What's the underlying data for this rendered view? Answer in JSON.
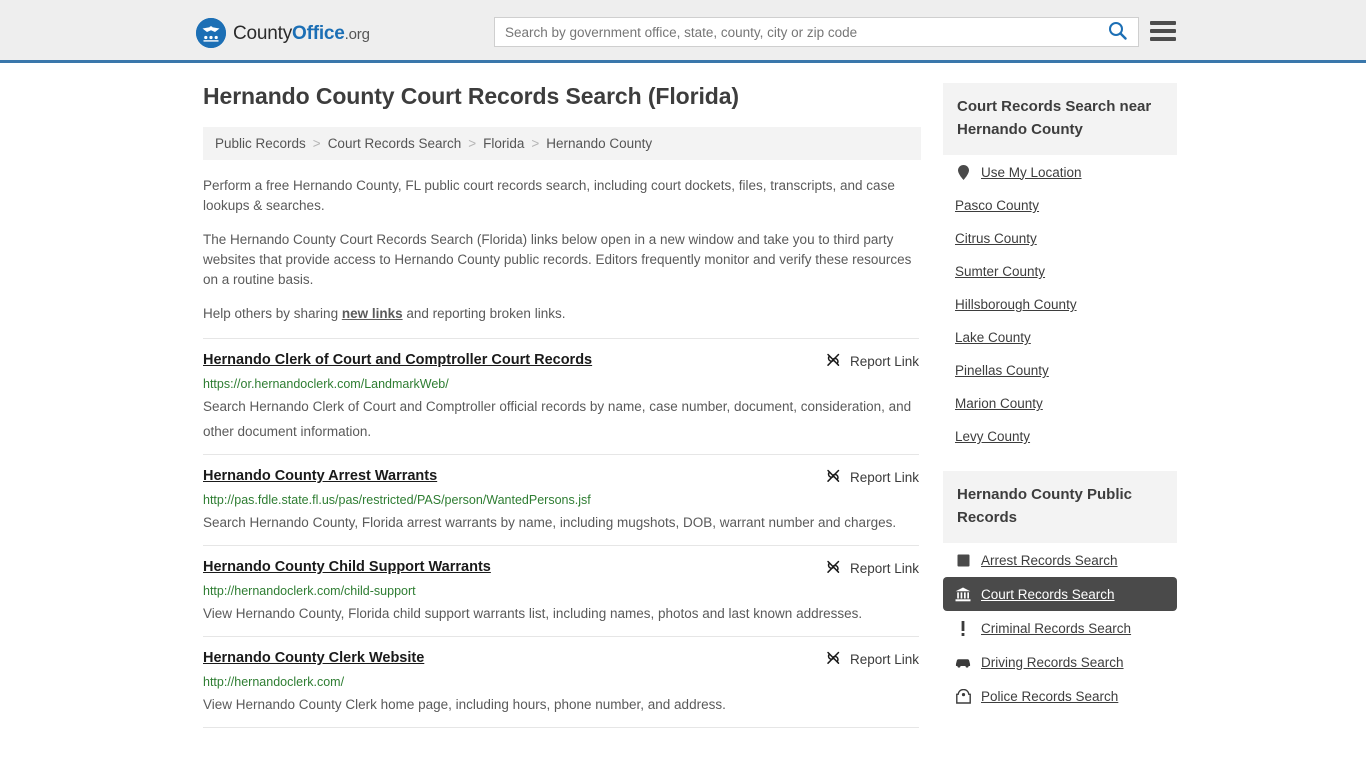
{
  "header": {
    "logo": {
      "name": "CountyOffice.org",
      "part1": "County",
      "part2": "Office",
      "part3": ".org",
      "icon": "eagle-seal-icon",
      "color": "#1c6fb5"
    },
    "search": {
      "placeholder": "Search by government office, state, county, city or zip code",
      "value": "",
      "button_icon": "search-icon",
      "button_color": "#1c6fb5"
    },
    "menu_icon": "hamburger-menu-icon",
    "background": "#eeeeee",
    "accent_border": "#3a77ab"
  },
  "main": {
    "title": "Hernando County Court Records Search (Florida)",
    "breadcrumb": {
      "separator": ">",
      "items": [
        {
          "label": "Public Records",
          "current": false
        },
        {
          "label": "Court Records Search",
          "current": false
        },
        {
          "label": "Florida",
          "current": false
        },
        {
          "label": "Hernando County",
          "current": true
        }
      ]
    },
    "paragraphs": [
      "Perform a free Hernando County, FL public court records search, including court dockets, files, transcripts, and case lookups & searches.",
      "The Hernando County Court Records Search (Florida) links below open in a new window and take you to third party websites that provide access to Hernando County public records. Editors frequently monitor and verify these resources on a routine basis."
    ],
    "help_line": {
      "before": "Help others by sharing ",
      "link": "new links",
      "after": " and reporting broken links."
    },
    "report_label": "Report Link",
    "report_icon": "broken-link-icon",
    "links": [
      {
        "title": "Hernando Clerk of Court and Comptroller Court Records",
        "url": "https://or.hernandoclerk.com/LandmarkWeb/",
        "description": "Search Hernando Clerk of Court and Comptroller official records by name, case number, document, consideration, and other document information."
      },
      {
        "title": "Hernando County Arrest Warrants",
        "url": "http://pas.fdle.state.fl.us/pas/restricted/PAS/person/WantedPersons.jsf",
        "description": "Search Hernando County, Florida arrest warrants by name, including mugshots, DOB, warrant number and charges."
      },
      {
        "title": "Hernando County Child Support Warrants",
        "url": "http://hernandoclerk.com/child-support",
        "description": "View Hernando County, Florida child support warrants list, including names, photos and last known addresses."
      },
      {
        "title": "Hernando County Clerk Website",
        "url": "http://hernandoclerk.com/",
        "description": "View Hernando County Clerk home page, including hours, phone number, and address."
      }
    ]
  },
  "sidebar": {
    "nearby": {
      "heading": "Court Records Search near Hernando County",
      "use_my_location": {
        "label": "Use My Location",
        "icon": "map-pin-icon"
      },
      "counties": [
        {
          "label": "Pasco County"
        },
        {
          "label": "Citrus County"
        },
        {
          "label": "Sumter County"
        },
        {
          "label": "Hillsborough County"
        },
        {
          "label": "Lake County"
        },
        {
          "label": "Pinellas County"
        },
        {
          "label": "Marion County"
        },
        {
          "label": "Levy County"
        }
      ]
    },
    "public_records": {
      "heading": "Hernando County Public Records",
      "active_color": "#4a4a4a",
      "items": [
        {
          "label": "Arrest Records Search",
          "icon": "fingerprint-square-icon",
          "active": false
        },
        {
          "label": "Court Records Search",
          "icon": "courthouse-icon",
          "active": true
        },
        {
          "label": "Criminal Records Search",
          "icon": "exclamation-icon",
          "active": false
        },
        {
          "label": "Driving Records Search",
          "icon": "car-icon",
          "active": false
        },
        {
          "label": "Police Records Search",
          "icon": "police-badge-icon",
          "active": false
        }
      ]
    }
  }
}
